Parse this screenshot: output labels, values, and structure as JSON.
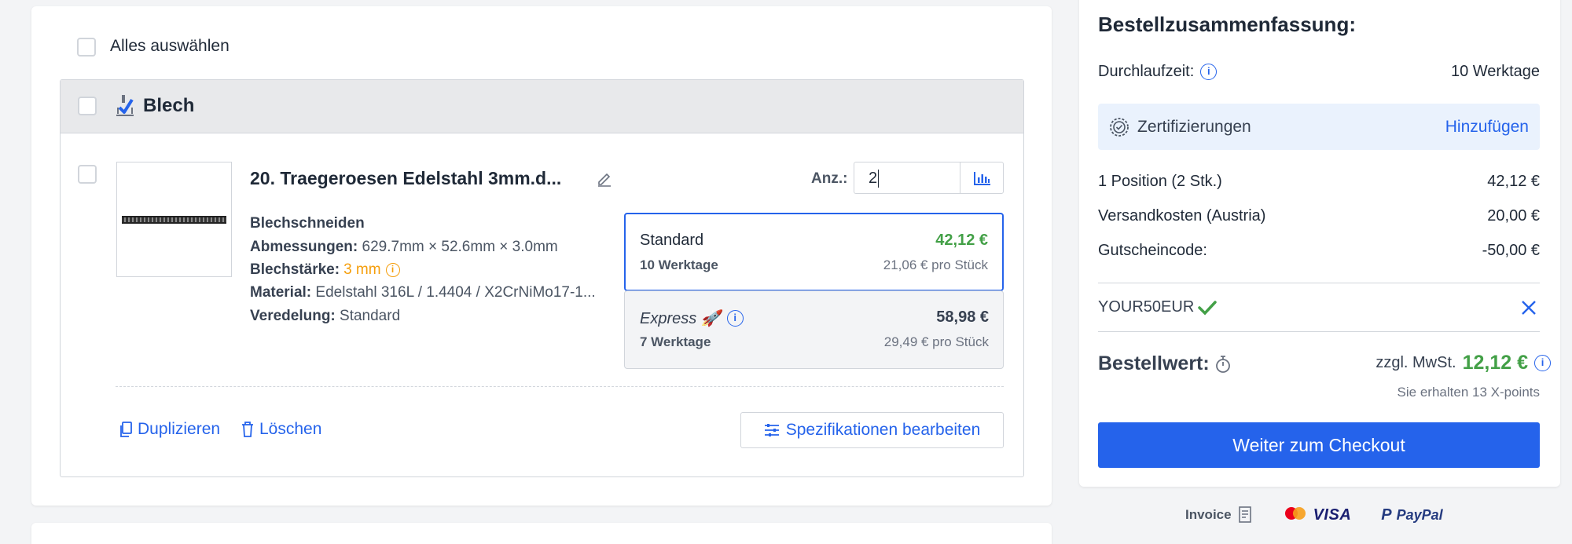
{
  "select_all_label": "Alles auswählen",
  "group": {
    "title": "Blech"
  },
  "item": {
    "title": "20. Traegeroesen Edelstahl 3mm.d...",
    "process": "Blechschneiden",
    "dimensions_label": "Abmessungen:",
    "dimensions_value": "629.7mm × 52.6mm × 3.0mm",
    "thickness_label": "Blechstärke:",
    "thickness_value": "3 mm",
    "material_label": "Material:",
    "material_value": "Edelstahl 316L / 1.4404 / X2CrNiMo17-1...",
    "finish_label": "Veredelung:",
    "finish_value": "Standard",
    "qty_label": "Anz.:",
    "qty_value": "2",
    "duplicate_label": "Duplizieren",
    "delete_label": "Löschen",
    "edit_specs_label": "Spezifikationen bearbeiten"
  },
  "delivery_options": [
    {
      "name": "Standard",
      "price": "42,12 €",
      "days": "10 Werktage",
      "unit_price": "21,06 € pro Stück",
      "selected": true
    },
    {
      "name": "Express 🚀",
      "price": "58,98 €",
      "days": "7 Werktage",
      "unit_price": "29,49 € pro Stück",
      "selected": false
    }
  ],
  "summary": {
    "title": "Bestellzusammenfassung:",
    "lead_time_label": "Durchlaufzeit:",
    "lead_time_value": "10 Werktage",
    "cert_label": "Zertifizierungen",
    "cert_action": "Hinzufügen",
    "position_label": "1 Position (2 Stk.)",
    "position_value": "42,12 €",
    "shipping_label": "Versandkosten (Austria)",
    "shipping_value": "20,00 €",
    "coupon_label": "Gutscheincode:",
    "coupon_value": "-50,00 €",
    "coupon_code": "YOUR50EUR",
    "order_value_label": "Bestellwert:",
    "vat_note": "zzgl. MwSt.",
    "order_total": "12,12 €",
    "points_note": "Sie erhalten 13 X-points",
    "checkout_label": "Weiter zum Checkout"
  },
  "payment_methods": {
    "invoice": "Invoice",
    "visa": "VISA",
    "paypal": "PayPal"
  },
  "colors": {
    "accent": "#2563eb",
    "price_green": "#43a047",
    "warning": "#f59e0b"
  }
}
